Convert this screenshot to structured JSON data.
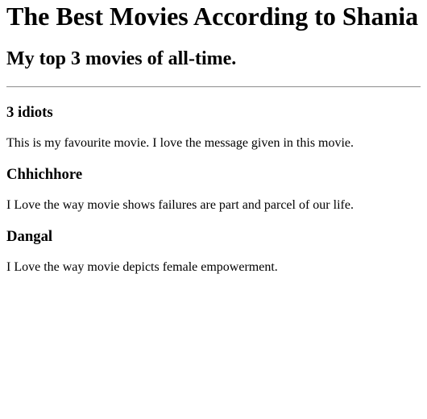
{
  "page": {
    "title": "The Best Movies According to Shania",
    "subtitle": "My top 3 movies of all-time."
  },
  "movies": [
    {
      "name": "3 idiots",
      "description": "This is my favourite movie. I love the message given in this movie."
    },
    {
      "name": "Chhichhore",
      "description": "I Love the way movie shows failures are part and parcel of our life."
    },
    {
      "name": "Dangal",
      "description": "I Love the way movie depicts female empowerment."
    }
  ]
}
